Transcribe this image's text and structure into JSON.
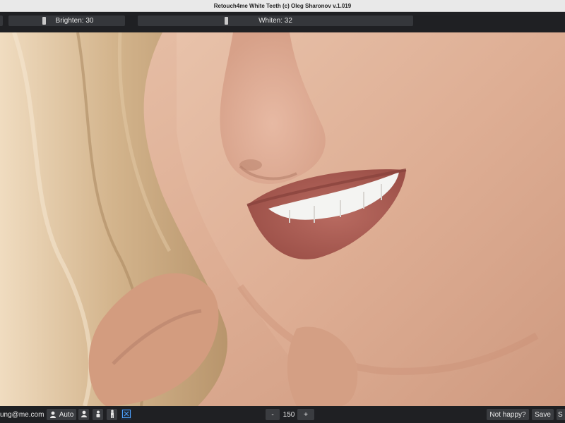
{
  "window": {
    "title": "Retouch4me White Teeth (c) Oleg Sharonov v.1.019"
  },
  "toolbar": {
    "brighten_label": "Brighten: 30",
    "brighten_value": 30,
    "whiten_label": "Whiten: 32",
    "whiten_value": 32
  },
  "bottom": {
    "email": "ung@me.com",
    "auto_label": "Auto",
    "zoom_minus": "-",
    "zoom_value": "150",
    "zoom_plus": "+",
    "not_happy_label": "Not happy?",
    "save_label": "Save",
    "save_as_label": "S"
  },
  "colors": {
    "accent_blue": "#4ea3ff",
    "bar_bg": "#1f2023"
  }
}
